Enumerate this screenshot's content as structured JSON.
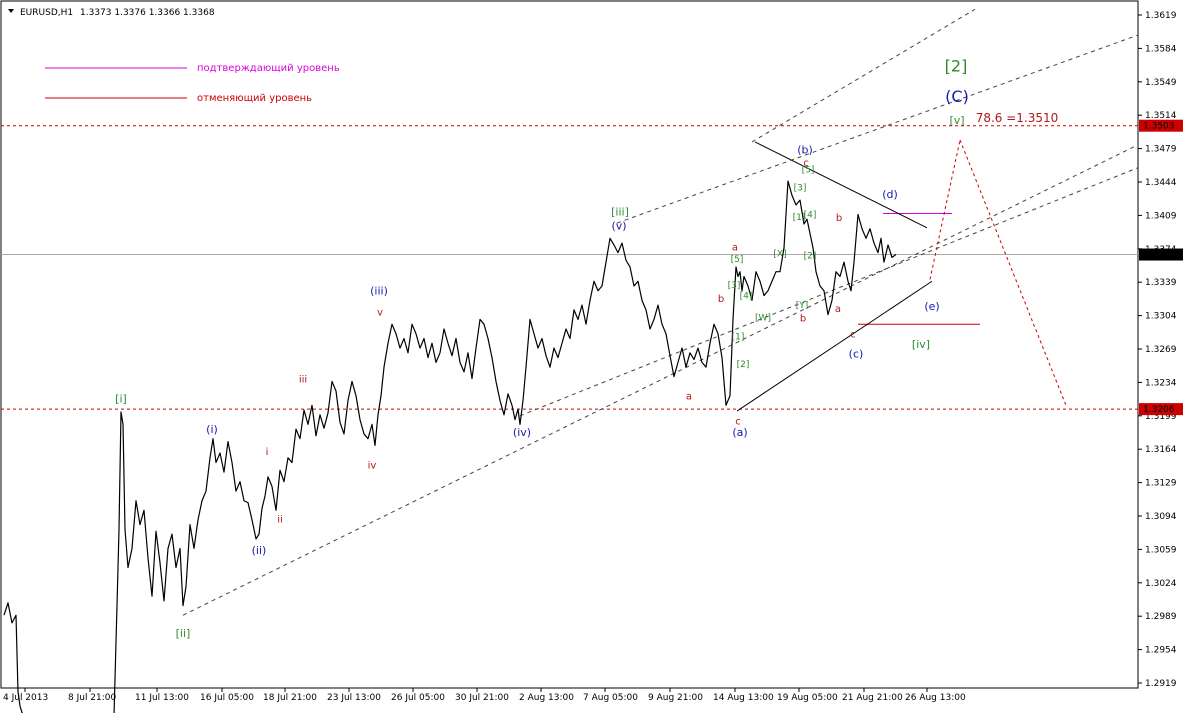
{
  "header": {
    "symbol": "EURUSD,H1",
    "ohlc": "1.3373 1.3376 1.3366 1.3368"
  },
  "legend": [
    {
      "label": "подтверждающий уровень",
      "color": "#dd00dd"
    },
    {
      "label": "отменяющий уровень",
      "color": "#cc0000"
    }
  ],
  "colors": {
    "wave_blue": "#1a1aaa",
    "wave_green": "#2e8b2e",
    "wave_red": "#b01818",
    "level_red": "#cc0000",
    "level_magenta": "#dd00dd",
    "price": "#000000",
    "current_line": "#aaaaaa"
  },
  "chart_data": {
    "type": "line",
    "title": "",
    "xlabel": "",
    "ylabel": "",
    "ylim": [
      1.2905,
      1.3635
    ],
    "y_ticks": [
      "1.3619",
      "1.3584",
      "1.3549",
      "1.3514",
      "1.3479",
      "1.3444",
      "1.3409",
      "1.3374",
      "1.3339",
      "1.3304",
      "1.3269",
      "1.3234",
      "1.3199",
      "1.3164",
      "1.3129",
      "1.3094",
      "1.3059",
      "1.3024",
      "1.2989",
      "1.2954",
      "1.2919"
    ],
    "x_range": [
      0,
      1130
    ],
    "x_ticks": [
      {
        "pos": 25,
        "label": "4 Jul 2013"
      },
      {
        "pos": 90,
        "label": "8 Jul 21:00"
      },
      {
        "pos": 157,
        "label": "11 Jul 13:00"
      },
      {
        "pos": 222,
        "label": "16 Jul 05:00"
      },
      {
        "pos": 285,
        "label": "18 Jul 21:00"
      },
      {
        "pos": 349,
        "label": "23 Jul 13:00"
      },
      {
        "pos": 413,
        "label": "26 Jul 05:00"
      },
      {
        "pos": 477,
        "label": "30 Jul 21:00"
      },
      {
        "pos": 541,
        "label": "2 Aug 13:00"
      },
      {
        "pos": 605,
        "label": "7 Aug 05:00"
      },
      {
        "pos": 670,
        "label": "9 Aug 21:00"
      },
      {
        "pos": 735,
        "label": "14 Aug 13:00"
      },
      {
        "pos": 799,
        "label": "19 Aug 05:00"
      },
      {
        "pos": 864,
        "label": "21 Aug 21:00"
      },
      {
        "pos": 927,
        "label": "26 Aug 13:00"
      }
    ],
    "price_series": {
      "name": "",
      "x": [
        4,
        8,
        12,
        16,
        18,
        20,
        22,
        25,
        28,
        32,
        36,
        42,
        48,
        54,
        60,
        66,
        72,
        80,
        88,
        96,
        104,
        110,
        114,
        117,
        119,
        121,
        123,
        125,
        128,
        132,
        136,
        140,
        144,
        148,
        152,
        156,
        160,
        164,
        168,
        172,
        176,
        180,
        183,
        186,
        190,
        194,
        198,
        202,
        206,
        210,
        213,
        216,
        220,
        224,
        228,
        232,
        236,
        240,
        244,
        248,
        252,
        256,
        259,
        262,
        265,
        268,
        272,
        276,
        280,
        284,
        288,
        292,
        296,
        300,
        304,
        308,
        312,
        316,
        320,
        324,
        328,
        332,
        336,
        340,
        344,
        348,
        352,
        356,
        360,
        364,
        368,
        372,
        375,
        378,
        381,
        384,
        388,
        392,
        396,
        400,
        404,
        408,
        412,
        416,
        420,
        424,
        428,
        432,
        436,
        440,
        444,
        448,
        452,
        456,
        460,
        464,
        468,
        472,
        476,
        480,
        484,
        488,
        492,
        496,
        500,
        504,
        508,
        512,
        515,
        518,
        520,
        523,
        526,
        530,
        534,
        538,
        542,
        546,
        550,
        554,
        558,
        562,
        566,
        570,
        574,
        578,
        582,
        586,
        590,
        594,
        598,
        602,
        606,
        610,
        614,
        618,
        622,
        626,
        630,
        634,
        638,
        642,
        646,
        650,
        654,
        658,
        662,
        666,
        670,
        674,
        678,
        682,
        686,
        690,
        694,
        698,
        702,
        706,
        710,
        714,
        718,
        722,
        726,
        730,
        733,
        736,
        738,
        740,
        742,
        744,
        748,
        752,
        756,
        760,
        764,
        768,
        772,
        776,
        780,
        784,
        788,
        792,
        796,
        800,
        804,
        807,
        810,
        813,
        816,
        820,
        824,
        828,
        832,
        836,
        840,
        844,
        848,
        851,
        854,
        858,
        862,
        866,
        870,
        874,
        878,
        881,
        884,
        888,
        892,
        896,
        900,
        904,
        908,
        912,
        916,
        920,
        923
      ],
      "y": [
        1.299,
        1.3003,
        1.2982,
        1.299,
        1.291,
        1.2895,
        1.2888,
        1.2882,
        1.2878,
        1.2874,
        1.2876,
        1.2873,
        1.2875,
        1.2872,
        1.2874,
        1.2871,
        1.2873,
        1.2872,
        1.287,
        1.2872,
        1.2871,
        1.288,
        1.2885,
        1.3,
        1.308,
        1.3203,
        1.319,
        1.308,
        1.304,
        1.306,
        1.311,
        1.3085,
        1.31,
        1.305,
        1.301,
        1.3078,
        1.3045,
        1.3005,
        1.306,
        1.3075,
        1.304,
        1.306,
        1.3,
        1.302,
        1.3085,
        1.306,
        1.309,
        1.311,
        1.312,
        1.3155,
        1.3175,
        1.315,
        1.316,
        1.314,
        1.3172,
        1.315,
        1.312,
        1.313,
        1.311,
        1.3108,
        1.309,
        1.307,
        1.3075,
        1.3102,
        1.3115,
        1.3135,
        1.3125,
        1.31,
        1.3142,
        1.313,
        1.3155,
        1.315,
        1.3185,
        1.3175,
        1.3205,
        1.319,
        1.321,
        1.3178,
        1.32,
        1.3186,
        1.3202,
        1.3235,
        1.3225,
        1.3192,
        1.318,
        1.3215,
        1.3235,
        1.322,
        1.3195,
        1.318,
        1.3175,
        1.319,
        1.3168,
        1.32,
        1.322,
        1.325,
        1.3275,
        1.3295,
        1.3285,
        1.327,
        1.328,
        1.3265,
        1.3295,
        1.3285,
        1.327,
        1.328,
        1.326,
        1.3275,
        1.3255,
        1.3265,
        1.329,
        1.3275,
        1.3262,
        1.328,
        1.3255,
        1.3245,
        1.3265,
        1.3238,
        1.327,
        1.33,
        1.3295,
        1.328,
        1.326,
        1.3235,
        1.3215,
        1.32,
        1.3222,
        1.321,
        1.3195,
        1.3206,
        1.319,
        1.3215,
        1.325,
        1.33,
        1.3285,
        1.327,
        1.328,
        1.3262,
        1.325,
        1.327,
        1.326,
        1.3275,
        1.329,
        1.328,
        1.331,
        1.33,
        1.3315,
        1.3295,
        1.332,
        1.334,
        1.333,
        1.3335,
        1.336,
        1.3385,
        1.3378,
        1.337,
        1.338,
        1.3362,
        1.3355,
        1.3335,
        1.334,
        1.332,
        1.331,
        1.329,
        1.33,
        1.3315,
        1.3295,
        1.3285,
        1.3262,
        1.324,
        1.3255,
        1.327,
        1.325,
        1.3265,
        1.3258,
        1.327,
        1.3255,
        1.325,
        1.3275,
        1.3295,
        1.3285,
        1.326,
        1.321,
        1.322,
        1.33,
        1.3355,
        1.3345,
        1.335,
        1.333,
        1.3345,
        1.3335,
        1.332,
        1.335,
        1.334,
        1.3325,
        1.333,
        1.334,
        1.335,
        1.335,
        1.3375,
        1.3445,
        1.343,
        1.342,
        1.3425,
        1.34,
        1.3405,
        1.339,
        1.3375,
        1.335,
        1.3335,
        1.333,
        1.3305,
        1.332,
        1.335,
        1.3345,
        1.336,
        1.334,
        1.333,
        1.336,
        1.341,
        1.3395,
        1.3385,
        1.3395,
        1.338,
        1.337,
        1.3385,
        1.336,
        1.3378,
        1.3365,
        1.3368
      ]
    },
    "horizontal_levels": [
      {
        "price": 1.3503,
        "label": "1.3503",
        "color": "#cc0000",
        "style": "dotted"
      },
      {
        "price": 1.3206,
        "label": "1.3206",
        "color": "#cc0000",
        "style": "dotted"
      },
      {
        "price": 1.3368,
        "label": "1.3368",
        "color": "#aaaaaa",
        "style": "solid"
      }
    ],
    "segments": [
      {
        "x1": 883,
        "y1": 1.3411,
        "x2": 952,
        "y2": 1.3411,
        "color": "#dd00dd",
        "dash": ""
      },
      {
        "x1": 858,
        "y1": 1.3295,
        "x2": 980,
        "y2": 1.3295,
        "color": "#cc0000",
        "dash": ""
      },
      {
        "x1": 755,
        "y1": 1.3486,
        "x2": 927,
        "y2": 1.3396,
        "color": "#000000",
        "dash": ""
      },
      {
        "x1": 737,
        "y1": 1.3204,
        "x2": 932,
        "y2": 1.334,
        "color": "#000000",
        "dash": ""
      },
      {
        "x1": 930,
        "y1": 1.3342,
        "x2": 960,
        "y2": 1.3488,
        "color": "#cc0000",
        "dash": "3,3"
      },
      {
        "x1": 960,
        "y1": 1.3488,
        "x2": 1066,
        "y2": 1.321,
        "color": "#cc0000",
        "dash": "3,3"
      },
      {
        "x1": 183,
        "y1": 1.299,
        "x2": 1138,
        "y2": 1.3483,
        "color": "#444444",
        "dash": "4,4"
      },
      {
        "x1": 617,
        "y1": 1.3401,
        "x2": 1138,
        "y2": 1.3598,
        "color": "#444444",
        "dash": "4,4"
      },
      {
        "x1": 752,
        "y1": 1.3486,
        "x2": 975,
        "y2": 1.3625,
        "color": "#444444",
        "dash": "4,4"
      },
      {
        "x1": 520,
        "y1": 1.3199,
        "x2": 1138,
        "y2": 1.3459,
        "color": "#444444",
        "dash": "4,4"
      }
    ],
    "annotations": [
      {
        "text": "[i]",
        "x": 121,
        "y": 1.3213,
        "color": "green",
        "size": 11
      },
      {
        "text": "[ii]",
        "x": 183,
        "y": 1.2967,
        "color": "green",
        "size": 11
      },
      {
        "text": "[iii]",
        "x": 620,
        "y": 1.3409,
        "color": "green",
        "size": 11
      },
      {
        "text": "[iv]",
        "x": 921,
        "y": 1.327,
        "color": "green",
        "size": 11
      },
      {
        "text": "[v]",
        "x": 957,
        "y": 1.3505,
        "color": "green",
        "size": 11
      },
      {
        "text": "[2]",
        "x": 956,
        "y": 1.356,
        "color": "green",
        "size": 16
      },
      {
        "text": "(C)",
        "x": 957,
        "y": 1.3528,
        "color": "blue",
        "size": 16
      },
      {
        "text": "(i)",
        "x": 212,
        "y": 1.3181,
        "color": "blue",
        "size": 11
      },
      {
        "text": "(ii)",
        "x": 259,
        "y": 1.3054,
        "color": "blue",
        "size": 11
      },
      {
        "text": "(iii)",
        "x": 379,
        "y": 1.3326,
        "color": "blue",
        "size": 11
      },
      {
        "text": "(iv)",
        "x": 522,
        "y": 1.3178,
        "color": "blue",
        "size": 11
      },
      {
        "text": "(v)",
        "x": 619,
        "y": 1.3394,
        "color": "blue",
        "size": 11
      },
      {
        "text": "(a)",
        "x": 740,
        "y": 1.3178,
        "color": "blue",
        "size": 11
      },
      {
        "text": "(b)",
        "x": 805,
        "y": 1.3474,
        "color": "blue",
        "size": 11
      },
      {
        "text": "(c)",
        "x": 856,
        "y": 1.326,
        "color": "blue",
        "size": 11
      },
      {
        "text": "(d)",
        "x": 890,
        "y": 1.3427,
        "color": "blue",
        "size": 11
      },
      {
        "text": "(e)",
        "x": 932,
        "y": 1.331,
        "color": "blue",
        "size": 11
      },
      {
        "text": "v",
        "x": 380,
        "y": 1.3304,
        "color": "red",
        "size": 10
      },
      {
        "text": "iii",
        "x": 303,
        "y": 1.3234,
        "color": "red",
        "size": 10
      },
      {
        "text": "i",
        "x": 267,
        "y": 1.3158,
        "color": "red",
        "size": 10
      },
      {
        "text": "ii",
        "x": 280,
        "y": 1.3087,
        "color": "red",
        "size": 10
      },
      {
        "text": "iv",
        "x": 372,
        "y": 1.3144,
        "color": "red",
        "size": 10
      },
      {
        "text": "a",
        "x": 689,
        "y": 1.3216,
        "color": "red",
        "size": 10
      },
      {
        "text": "b",
        "x": 721,
        "y": 1.3318,
        "color": "red",
        "size": 10
      },
      {
        "text": "c",
        "x": 738,
        "y": 1.319,
        "color": "red",
        "size": 10
      },
      {
        "text": "a",
        "x": 735,
        "y": 1.3372,
        "color": "red",
        "size": 10
      },
      {
        "text": "b",
        "x": 803,
        "y": 1.3298,
        "color": "red",
        "size": 10
      },
      {
        "text": "c",
        "x": 806,
        "y": 1.3461,
        "color": "red",
        "size": 10
      },
      {
        "text": "b",
        "x": 839,
        "y": 1.3403,
        "color": "red",
        "size": 10
      },
      {
        "text": "a",
        "x": 838,
        "y": 1.3308,
        "color": "red",
        "size": 10
      },
      {
        "text": "c",
        "x": 853,
        "y": 1.3281,
        "color": "red",
        "size": 10
      },
      {
        "text": "[5]",
        "x": 737,
        "y": 1.336,
        "color": "green",
        "size": 9
      },
      {
        "text": "[3]",
        "x": 734,
        "y": 1.3333,
        "color": "green",
        "size": 9
      },
      {
        "text": "[4]",
        "x": 746,
        "y": 1.3322,
        "color": "green",
        "size": 9
      },
      {
        "text": "[1]",
        "x": 738,
        "y": 1.3279,
        "color": "green",
        "size": 9
      },
      {
        "text": "[2]",
        "x": 743,
        "y": 1.325,
        "color": "green",
        "size": 9
      },
      {
        "text": "[W]",
        "x": 763,
        "y": 1.3299,
        "color": "green",
        "size": 9
      },
      {
        "text": "[X]",
        "x": 780,
        "y": 1.3366,
        "color": "green",
        "size": 9
      },
      {
        "text": "[Y]",
        "x": 802,
        "y": 1.3312,
        "color": "green",
        "size": 9
      },
      {
        "text": "[5]",
        "x": 808,
        "y": 1.3454,
        "color": "green",
        "size": 9
      },
      {
        "text": "[3]",
        "x": 800,
        "y": 1.3435,
        "color": "green",
        "size": 9
      },
      {
        "text": "[1]",
        "x": 799,
        "y": 1.3404,
        "color": "green",
        "size": 9
      },
      {
        "text": "[4]",
        "x": 810,
        "y": 1.3407,
        "color": "green",
        "size": 9
      },
      {
        "text": "[2]",
        "x": 810,
        "y": 1.3364,
        "color": "green",
        "size": 9
      },
      {
        "text": "78.6 =1.3510",
        "x": 1017,
        "y": 1.3507,
        "color": "red",
        "size": 12
      }
    ]
  }
}
